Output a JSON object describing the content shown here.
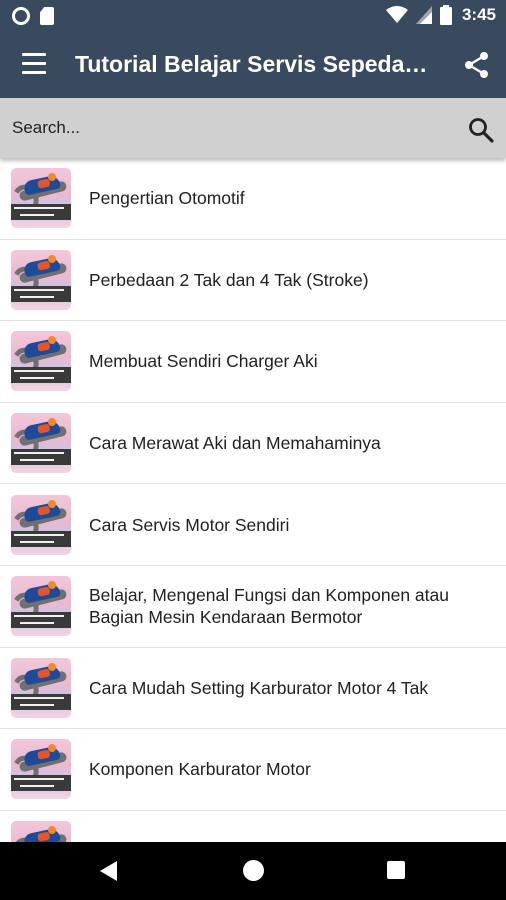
{
  "status_bar": {
    "time": "3:45",
    "left_icons": [
      "record-icon",
      "sd-card-icon"
    ],
    "right_icons": [
      "wifi-icon",
      "cell-signal-icon",
      "battery-icon"
    ]
  },
  "app_bar": {
    "title": "Tutorial Belajar Servis Sepeda Motor",
    "menu_icon": "hamburger-menu-icon",
    "share_icon": "share-icon",
    "background": "#3a4a5e"
  },
  "search": {
    "placeholder": "Search...",
    "value": "",
    "icon": "search-icon"
  },
  "list": {
    "items": [
      {
        "title": "Pengertian Otomotif"
      },
      {
        "title": "Perbedaan 2 Tak dan 4 Tak (Stroke)"
      },
      {
        "title": "Membuat Sendiri Charger Aki"
      },
      {
        "title": "Cara Merawat Aki dan Memahaminya"
      },
      {
        "title": "Cara Servis Motor Sendiri"
      },
      {
        "title": "Belajar, Mengenal Fungsi dan Komponen atau Bagian Mesin Kendaraan Bermotor"
      },
      {
        "title": "Cara Mudah Setting Karburator Motor 4 Tak"
      },
      {
        "title": "Komponen Karburator Motor"
      },
      {
        "title": ""
      }
    ]
  },
  "nav_bar": {
    "buttons": [
      "back-icon",
      "home-icon",
      "recent-apps-icon"
    ]
  }
}
